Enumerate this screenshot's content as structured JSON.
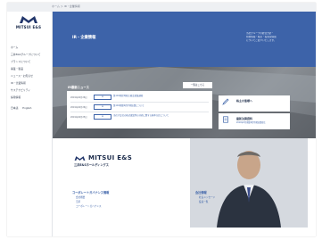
{
  "breadcrumb": "ホーム ＞ IR・企業情報",
  "brand": {
    "name": "MITSUI E&S",
    "sub": "三井E&Sホールディングス"
  },
  "sidebar": {
    "items": [
      {
        "label": "ホーム"
      },
      {
        "label": "三井E&Sグループについて"
      },
      {
        "label": "ブランドについて"
      },
      {
        "label": "事業・製品"
      },
      {
        "label": "ニュース・お知らせ"
      },
      {
        "label": "IR・企業情報"
      },
      {
        "label": "サステナビリティ"
      },
      {
        "label": "採用情報"
      }
    ],
    "lang": [
      "日本語",
      "English"
    ]
  },
  "hero": {
    "title": "IR・企業情報",
    "subtitle": [
      "当社グループの経営方針・",
      "財務情報・株主・投資家情報",
      "についてご紹介いたします。"
    ]
  },
  "news": {
    "title": "IR最新ニュース",
    "list_button": "一覧はこちら",
    "items": [
      {
        "date": "2019年04月26日",
        "tag": "IR",
        "text": "第116期定時株主総会招集通知"
      },
      {
        "date": "2019年04月26日",
        "tag": "IR",
        "text": "第116期第2四半期決算について"
      },
      {
        "date": "2019年04月25日",
        "tag": "IR",
        "text": "当社子会社の株式譲渡等の対処に関する基本方針について"
      }
    ]
  },
  "cards": [
    {
      "label": "株主の皆様へ",
      "sub": ""
    },
    {
      "label": "最新決算資料",
      "sub": "2019年3月期第2四半期決算短信"
    }
  ],
  "links": {
    "col1": {
      "head": "コーポレートガバナンス情報",
      "items": [
        "会社概要",
        "沿革",
        "コーポレートガバナンス"
      ]
    },
    "col2": {
      "head": "会社情報",
      "items": [
        "社長メッセージ",
        "役員一覧"
      ]
    }
  },
  "colors": {
    "accent": "#3d63a9",
    "dark_text": "#1a2a4a"
  },
  "icons": [
    "logo-mark-icon",
    "pen-icon",
    "document-icon",
    "portrait-image"
  ]
}
